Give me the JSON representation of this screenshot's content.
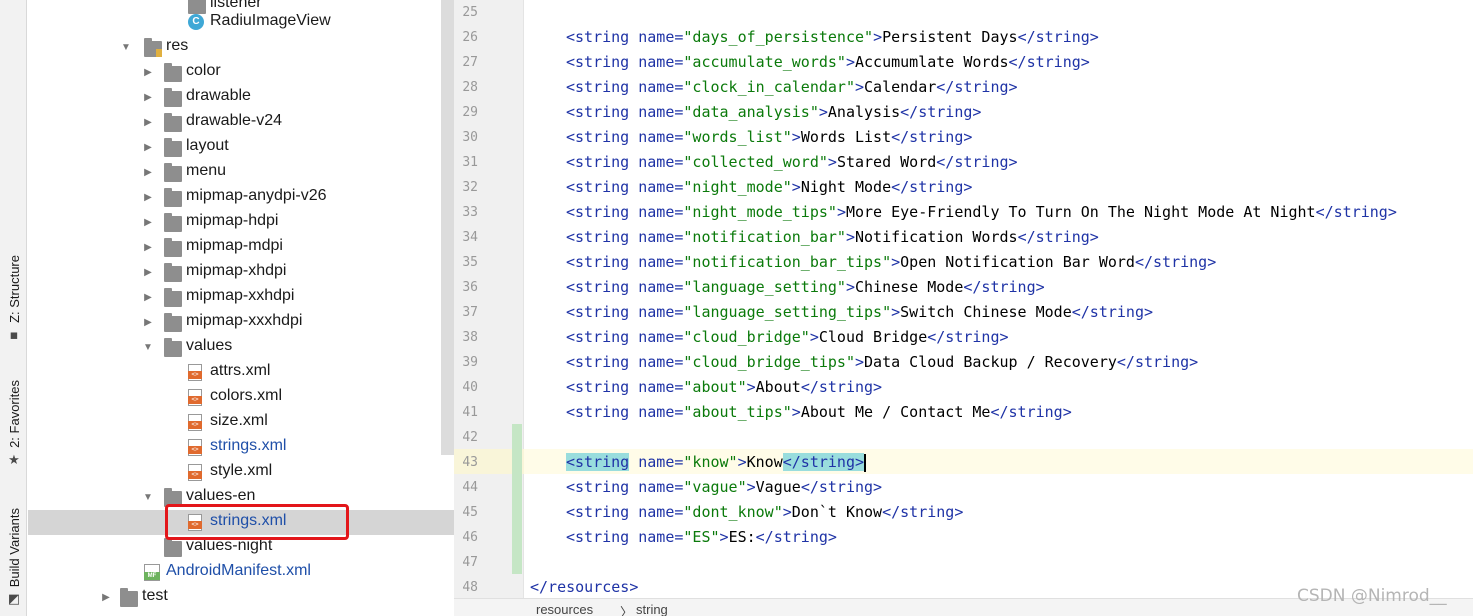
{
  "toolstrip": {
    "structure": "Z: Structure",
    "favorites": "2: Favorites",
    "build_variants": "Build Variants"
  },
  "tree": {
    "items": [
      {
        "label": "listener",
        "icon": "folder-icon"
      },
      {
        "label": "RadiuImageView",
        "icon": "class-icon"
      },
      {
        "label": "res",
        "icon": "res-folder-icon"
      },
      {
        "label": "color",
        "icon": "folder-icon"
      },
      {
        "label": "drawable",
        "icon": "folder-icon"
      },
      {
        "label": "drawable-v24",
        "icon": "folder-icon"
      },
      {
        "label": "layout",
        "icon": "folder-icon"
      },
      {
        "label": "menu",
        "icon": "folder-icon"
      },
      {
        "label": "mipmap-anydpi-v26",
        "icon": "folder-icon"
      },
      {
        "label": "mipmap-hdpi",
        "icon": "folder-icon"
      },
      {
        "label": "mipmap-mdpi",
        "icon": "folder-icon"
      },
      {
        "label": "mipmap-xhdpi",
        "icon": "folder-icon"
      },
      {
        "label": "mipmap-xxhdpi",
        "icon": "folder-icon"
      },
      {
        "label": "mipmap-xxxhdpi",
        "icon": "folder-icon"
      },
      {
        "label": "values",
        "icon": "folder-icon"
      },
      {
        "label": "attrs.xml",
        "icon": "xml-file-icon"
      },
      {
        "label": "colors.xml",
        "icon": "xml-file-icon"
      },
      {
        "label": "size.xml",
        "icon": "xml-file-icon"
      },
      {
        "label": "strings.xml",
        "icon": "xml-file-icon"
      },
      {
        "label": "style.xml",
        "icon": "xml-file-icon"
      },
      {
        "label": "values-en",
        "icon": "folder-icon"
      },
      {
        "label": "strings.xml",
        "icon": "xml-file-icon"
      },
      {
        "label": "values-night",
        "icon": "folder-icon"
      },
      {
        "label": "AndroidManifest.xml",
        "icon": "manifest-file-icon"
      },
      {
        "label": "test",
        "icon": "folder-icon"
      }
    ]
  },
  "editor": {
    "line_numbers": [
      "25",
      "26",
      "27",
      "28",
      "29",
      "30",
      "31",
      "32",
      "33",
      "34",
      "35",
      "36",
      "37",
      "38",
      "39",
      "40",
      "41",
      "42",
      "43",
      "44",
      "45",
      "46",
      "47",
      "48"
    ],
    "lines": [
      {
        "name": "",
        "text": ""
      },
      {
        "name": "days_of_persistence",
        "text": "Persistent Days"
      },
      {
        "name": "accumulate_words",
        "text": "Accumumlate Words"
      },
      {
        "name": "clock_in_calendar",
        "text": "Calendar"
      },
      {
        "name": "data_analysis",
        "text": "Analysis"
      },
      {
        "name": "words_list",
        "text": "Words List"
      },
      {
        "name": "collected_word",
        "text": "Stared Word"
      },
      {
        "name": "night_mode",
        "text": "Night Mode"
      },
      {
        "name": "night_mode_tips",
        "text": "More Eye-Friendly To Turn On The Night Mode At Night"
      },
      {
        "name": "notification_bar",
        "text": "Notification Words"
      },
      {
        "name": "notification_bar_tips",
        "text": "Open Notification Bar Word"
      },
      {
        "name": "language_setting",
        "text": "Chinese Mode"
      },
      {
        "name": "language_setting_tips",
        "text": "Switch Chinese Mode"
      },
      {
        "name": "cloud_bridge",
        "text": "Cloud Bridge"
      },
      {
        "name": "cloud_bridge_tips",
        "text": "Data Cloud Backup / Recovery"
      },
      {
        "name": "about",
        "text": "About"
      },
      {
        "name": "about_tips",
        "text": "About Me / Contact Me"
      },
      {
        "name": "",
        "text": ""
      },
      {
        "name": "know",
        "text": "Know"
      },
      {
        "name": "vague",
        "text": "Vague"
      },
      {
        "name": "dont_know",
        "text": "Don`t Know"
      },
      {
        "name": "ES",
        "text": "ES:"
      },
      {
        "name": "",
        "text": ""
      },
      {
        "name": "",
        "text": "</resources>"
      }
    ]
  },
  "syntax": {
    "open_tag": "<string",
    "attr": " name=",
    "close_tag": "</string>",
    "gt": ">"
  },
  "breadcrumb": {
    "first": "resources",
    "sep": "〉",
    "second": "string"
  },
  "watermark": "CSDN @Nimrod__",
  "colors": {
    "tag": "#1f33a6",
    "value": "#0b7a0b",
    "highlight_border": "#e3161a",
    "selection": "#d5d5d5"
  }
}
